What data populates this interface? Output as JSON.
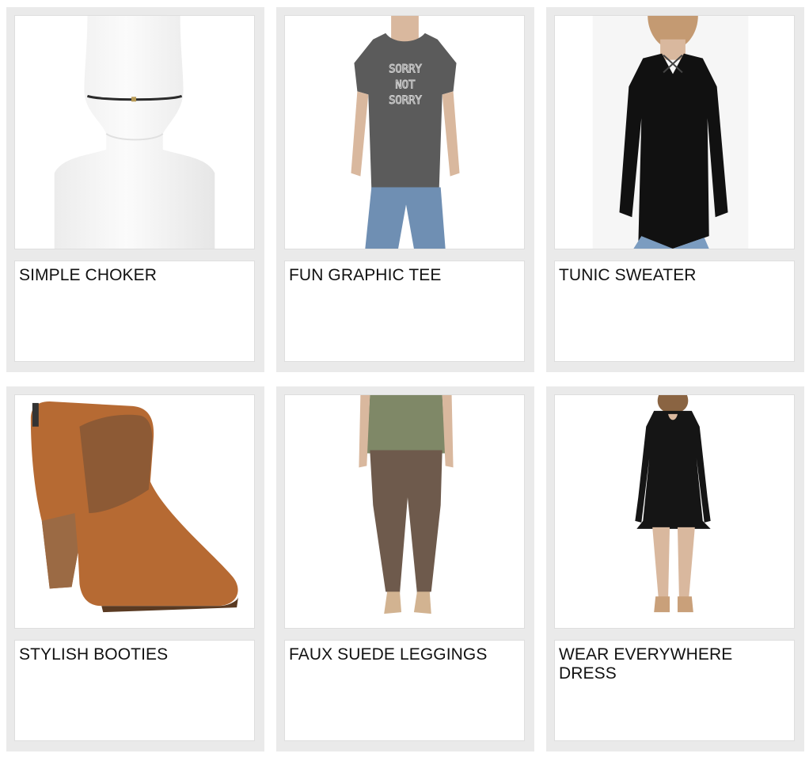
{
  "products": [
    {
      "title": "SIMPLE CHOKER",
      "image_icon": "choker-necklace-image"
    },
    {
      "title": "FUN GRAPHIC TEE",
      "image_icon": "graphic-tee-image",
      "image_text": [
        "SORRY",
        "NOT",
        "SORRY"
      ]
    },
    {
      "title": "TUNIC SWEATER",
      "image_icon": "tunic-sweater-image"
    },
    {
      "title": "STYLISH BOOTIES",
      "image_icon": "ankle-bootie-image"
    },
    {
      "title": "FAUX SUEDE LEGGINGS",
      "image_icon": "suede-leggings-image"
    },
    {
      "title": "WEAR EVERYWHERE DRESS",
      "image_icon": "black-dress-image"
    }
  ],
  "colors": {
    "card_background": "#eaeaea",
    "panel_background": "#ffffff",
    "text": "#111111"
  }
}
